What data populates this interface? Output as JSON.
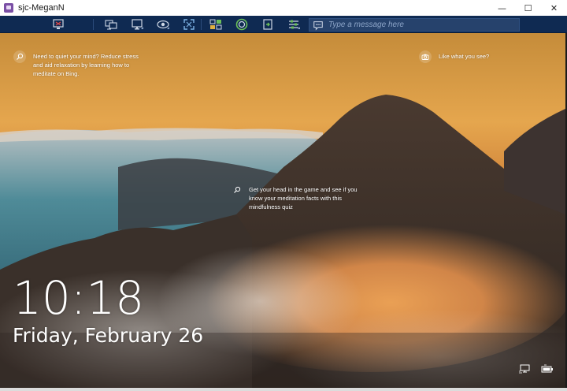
{
  "window": {
    "title": "sjc-MeganN",
    "minimize_glyph": "—",
    "maximize_glyph": "☐",
    "close_glyph": "✕"
  },
  "toolbar": {
    "icons": [
      "remote-desktop-icon",
      "switch-monitor-icon",
      "display-settings-icon",
      "view-only-icon",
      "fit-to-window-icon",
      "file-transfer-icon",
      "record-session-icon",
      "clipboard-transfer-icon",
      "system-tools-icon",
      "chat-icon"
    ],
    "message_placeholder": "Type a message here"
  },
  "lockscreen": {
    "tip_left": "Need to quiet your mind? Reduce stress and aid relaxation by learning how to meditate on Bing.",
    "tip_right": "Like what you see?",
    "tip_center": "Get your head in the game and see if you know your meditation facts with this mindfulness quiz",
    "time": "10:18",
    "date": "Friday, February 26"
  },
  "colors": {
    "toolbar_bg": "#0f2a52",
    "message_box_bg": "#26426c",
    "app_icon": "#7a4fa5"
  }
}
